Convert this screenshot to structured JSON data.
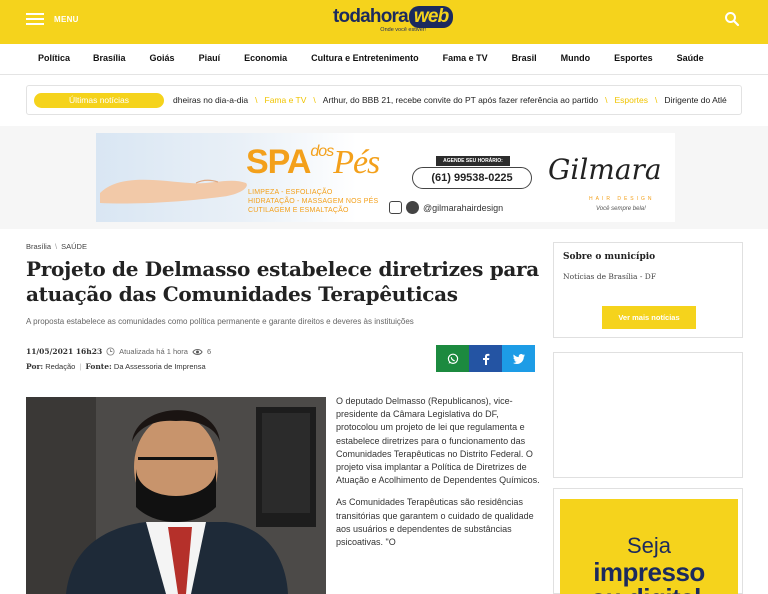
{
  "colors": {
    "brand_yellow": "#f5d31c",
    "brand_navy": "#1b2a5e",
    "whatsapp": "#1c8a3f",
    "facebook": "#2454a3",
    "twitter": "#1d9ce6"
  },
  "header": {
    "menu_label": "MENU",
    "logo_main": "todahora",
    "logo_web": "web",
    "logo_tagline": "Onde você estiver!"
  },
  "nav": {
    "items": [
      "Política",
      "Brasília",
      "Goiás",
      "Piauí",
      "Economia",
      "Cultura e Entretenimento",
      "Fama e TV",
      "Brasil",
      "Mundo",
      "Esportes",
      "Saúde"
    ]
  },
  "ticker": {
    "label": "Últimas notícias",
    "item1_text": "dheiras no dia-a-dia",
    "item2_tag": "Fama e TV",
    "item2_text": "Arthur, do BBB 21, recebe convite do PT após fazer referência ao partido",
    "item3_tag": "Esportes",
    "item3_text": "Dirigente do Atlé"
  },
  "ad_banner": {
    "spa": "SPA",
    "des": "dos",
    "pes": "Pés",
    "desc_line1": "LIMPEZA - ESFOLIAÇÃO",
    "desc_line2": "HIDRATAÇÃO - MASSAGEM NOS PÉS",
    "desc_line3": "CUTILAGEM E ESMALTAÇÃO",
    "agende": "AGENDE SEU HORÁRIO:",
    "phone": "(61) 99538-0225",
    "handle": "@gilmarahairdesign",
    "brand": "Gilmara",
    "brand_sub": "HAIR DESIGN",
    "brand_sig": "Você sempre bela!"
  },
  "article": {
    "breadcrumb_1": "Brasília",
    "breadcrumb_2": "SAÚDE",
    "title": "Projeto de Delmasso estabelece diretrizes para atuação das Comunidades Terapêuticas",
    "subtitle": "A proposta estabelece as comunidades como política permanente e garante direitos e deveres às instituições",
    "date": "11/05/2021 16h23",
    "updated": "Atualizada há 1 hora",
    "views": "6",
    "by_label": "Por:",
    "by_value": "Redação",
    "source_label": "Fonte:",
    "source_value": "Da Assessoria de Imprensa",
    "paragraph1": "O deputado Delmasso (Republicanos), vice-presidente da Câmara Legislativa do DF, protocolou um projeto de lei que regulamenta e estabelece diretrizes para o funcionamento das Comunidades Terapêuticas no Distrito Federal. O projeto visa implantar a Política de Diretrizes de Atuação e Acolhimento de Dependentes Químicos.",
    "paragraph2": "As Comunidades Terapêuticas são residências transitórias que garantem o cuidado de qualidade aos usuários e dependentes de substâncias psicoativas. \"O"
  },
  "sidebar": {
    "heading": "Sobre o município",
    "sub": "Notícias de Brasília - DF",
    "button": "Ver mais notícias",
    "ad_line1": "Seja",
    "ad_line2": "impresso",
    "ad_line3": "ou digital."
  }
}
